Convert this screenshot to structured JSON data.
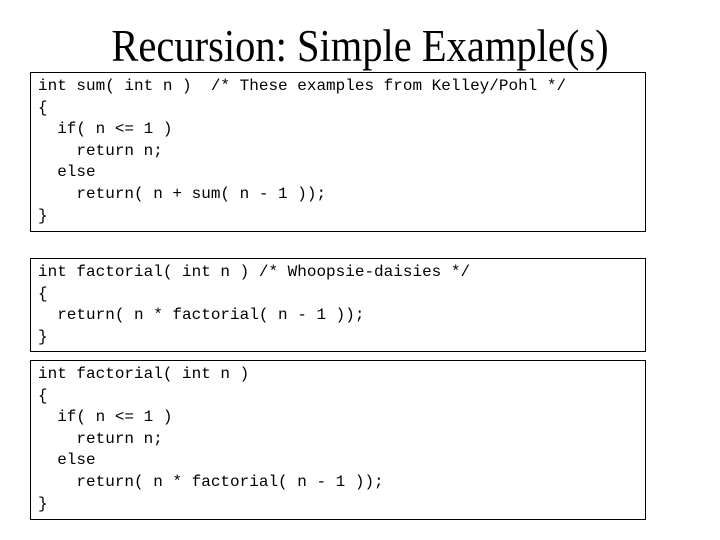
{
  "slide": {
    "title": "Recursion: Simple Example(s)"
  },
  "code_blocks": [
    {
      "lines": [
        "int sum( int n )  /* These examples from Kelley/Pohl */",
        "{",
        "  if( n <= 1 )",
        "    return n;",
        "  else",
        "    return( n + sum( n - 1 ));",
        "}"
      ]
    },
    {
      "lines": [
        "int factorial( int n ) /* Whoopsie-daisies */",
        "{",
        "  return( n * factorial( n - 1 ));",
        "}"
      ]
    },
    {
      "lines": [
        "int factorial( int n )",
        "{",
        "  if( n <= 1 )",
        "    return n;",
        "  else",
        "    return( n * factorial( n - 1 ));",
        "}"
      ]
    }
  ]
}
